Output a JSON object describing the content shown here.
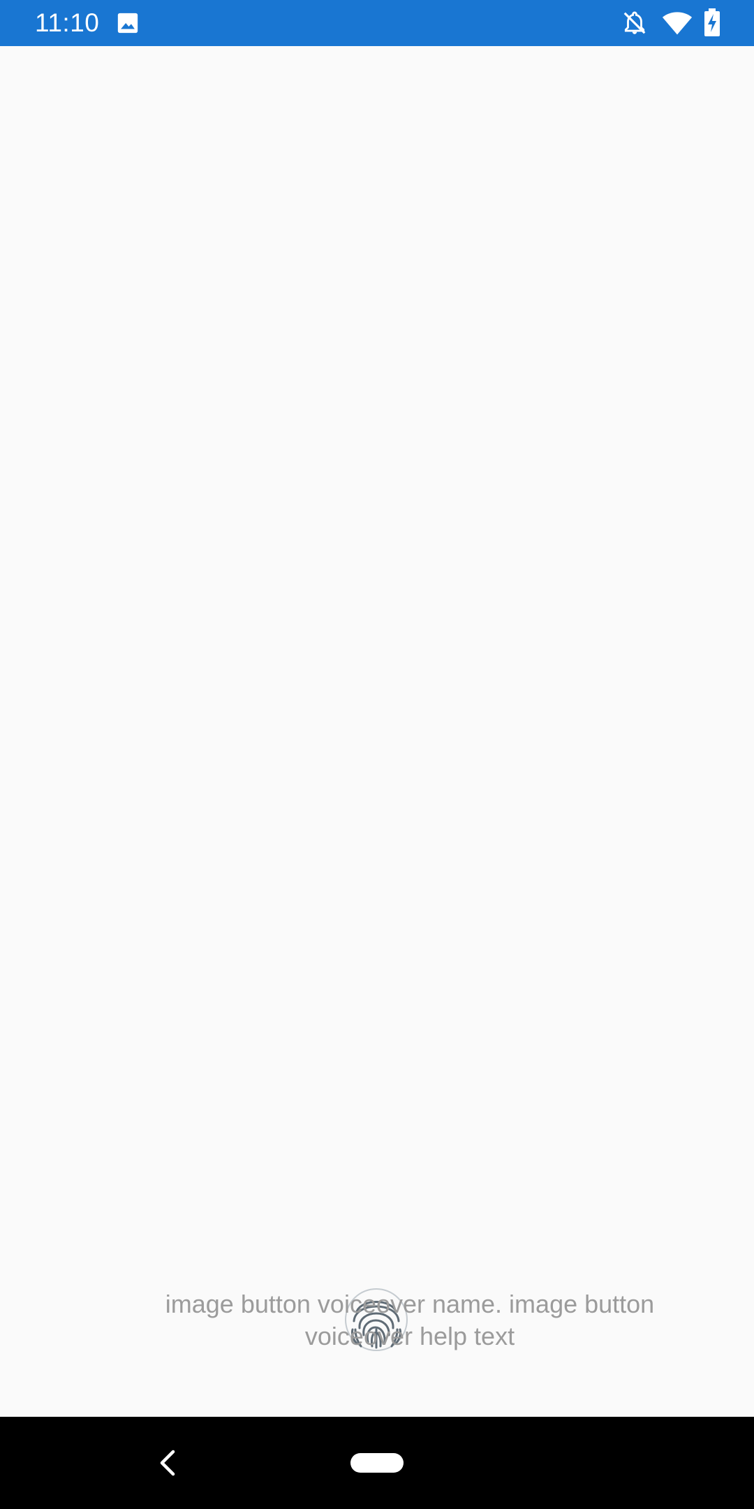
{
  "status_bar": {
    "time": "11:10",
    "background_color": "#1976d2",
    "icons": [
      "image-notification-icon",
      "bell-off-icon",
      "wifi-icon",
      "battery-charging-icon"
    ]
  },
  "main": {
    "background_color": "#fafafa",
    "image_button": {
      "icon": "fingerprint-icon",
      "caption": "image button voiceover name. image button voiceover help text"
    }
  },
  "nav_bar": {
    "background_color": "#000000",
    "icons": [
      "back-icon",
      "home-pill-icon"
    ]
  }
}
